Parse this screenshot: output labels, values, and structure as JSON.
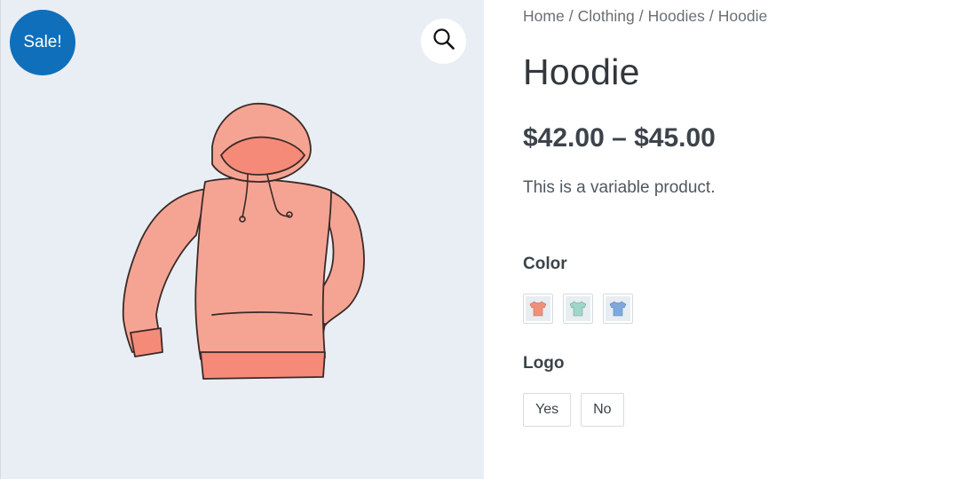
{
  "gallery": {
    "sale_badge": "Sale!",
    "zoom_icon": "magnifier-icon",
    "image": "hoodie-illustration"
  },
  "breadcrumb": {
    "items": [
      "Home",
      "Clothing",
      "Hoodies",
      "Hoodie"
    ],
    "separator": "/"
  },
  "product": {
    "title": "Hoodie",
    "price": "$42.00 – $45.00",
    "description": "This is a variable product."
  },
  "attributes": {
    "color": {
      "label": "Color",
      "swatches": [
        {
          "name": "red-tshirt-swatch",
          "color": "#f0907a"
        },
        {
          "name": "green-tshirt-swatch",
          "color": "#9fd6c8"
        },
        {
          "name": "blue-tshirt-swatch",
          "color": "#7fa9dc"
        }
      ]
    },
    "logo": {
      "label": "Logo",
      "options": [
        "Yes",
        "No"
      ]
    }
  },
  "colors": {
    "accent": "#0f6fba",
    "gallery_bg": "#e9eef4",
    "hoodie": "#f5a493"
  }
}
